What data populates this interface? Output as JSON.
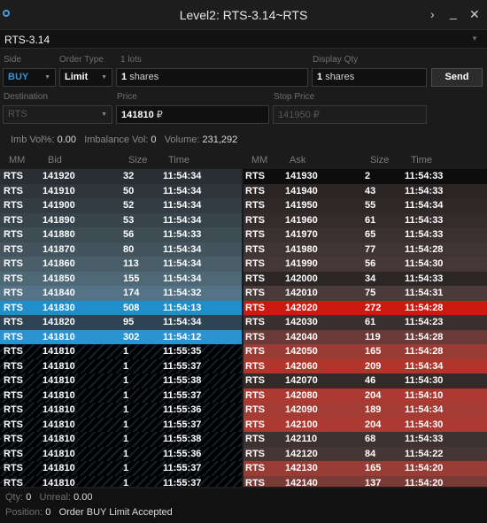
{
  "window": {
    "title": "Level2: RTS-3.14~RTS",
    "controls": {
      "expand": "›",
      "minimize": "_",
      "close": "✕"
    }
  },
  "symbol": "RTS-3.14",
  "order": {
    "side_label": "Side",
    "side_value": "BUY",
    "type_label": "Order Type",
    "type_value": "Limit",
    "lots_label": "1 lots",
    "qty_value": "1",
    "qty_unit": "shares",
    "display_qty_label": "Display Qty",
    "display_qty_value": "1",
    "display_qty_unit": "shares",
    "send_label": "Send",
    "destination_label": "Destination",
    "destination_value": "RTS",
    "price_label": "Price",
    "price_value": "141810",
    "price_unit": "₽",
    "stop_price_label": "Stop Price",
    "stop_price_value": "141950",
    "stop_price_unit": "₽"
  },
  "stats": {
    "imb_vol_label": "Imb Vol%:",
    "imb_vol_value": "0.00",
    "imbalance_label": "Imbalance Vol:",
    "imbalance_value": "0",
    "volume_label": "Volume:",
    "volume_value": "231,292"
  },
  "bid_book": {
    "columns": [
      "MM",
      "Bid",
      "Size",
      "Time"
    ],
    "rows": [
      {
        "mm": "RTS",
        "price": "141920",
        "size": "32",
        "time": "11:54:34",
        "bg": "#282e32",
        "hatch": false
      },
      {
        "mm": "RTS",
        "price": "141910",
        "size": "50",
        "time": "11:54:34",
        "bg": "#2e363b",
        "hatch": false
      },
      {
        "mm": "RTS",
        "price": "141900",
        "size": "52",
        "time": "11:54:34",
        "bg": "#323c42",
        "hatch": false
      },
      {
        "mm": "RTS",
        "price": "141890",
        "size": "53",
        "time": "11:54:34",
        "bg": "#38444b",
        "hatch": false
      },
      {
        "mm": "RTS",
        "price": "141880",
        "size": "56",
        "time": "11:54:33",
        "bg": "#3e4c54",
        "hatch": false
      },
      {
        "mm": "RTS",
        "price": "141870",
        "size": "80",
        "time": "11:54:34",
        "bg": "#44545e",
        "hatch": false
      },
      {
        "mm": "RTS",
        "price": "141860",
        "size": "113",
        "time": "11:54:34",
        "bg": "#4a5e69",
        "hatch": false
      },
      {
        "mm": "RTS",
        "price": "141850",
        "size": "155",
        "time": "11:54:34",
        "bg": "#4f6876",
        "hatch": false
      },
      {
        "mm": "RTS",
        "price": "141840",
        "size": "174",
        "time": "11:54:32",
        "bg": "#557386",
        "hatch": false
      },
      {
        "mm": "RTS",
        "price": "141830",
        "size": "508",
        "time": "11:54:13",
        "bg": "#1f8fcc",
        "hatch": false
      },
      {
        "mm": "RTS",
        "price": "141820",
        "size": "95",
        "time": "11:54:34",
        "bg": "#2c4454",
        "hatch": false
      },
      {
        "mm": "RTS",
        "price": "141810",
        "size": "302",
        "time": "11:54:12",
        "bg": "#2a93d0",
        "hatch": false
      },
      {
        "mm": "RTS",
        "price": "141810",
        "size": "1",
        "time": "11:55:35",
        "bg": "",
        "hatch": true
      },
      {
        "mm": "RTS",
        "price": "141810",
        "size": "1",
        "time": "11:55:37",
        "bg": "",
        "hatch": true
      },
      {
        "mm": "RTS",
        "price": "141810",
        "size": "1",
        "time": "11:55:38",
        "bg": "",
        "hatch": true
      },
      {
        "mm": "RTS",
        "price": "141810",
        "size": "1",
        "time": "11:55:37",
        "bg": "",
        "hatch": true
      },
      {
        "mm": "RTS",
        "price": "141810",
        "size": "1",
        "time": "11:55:36",
        "bg": "",
        "hatch": true
      },
      {
        "mm": "RTS",
        "price": "141810",
        "size": "1",
        "time": "11:55:37",
        "bg": "",
        "hatch": true
      },
      {
        "mm": "RTS",
        "price": "141810",
        "size": "1",
        "time": "11:55:38",
        "bg": "",
        "hatch": true
      },
      {
        "mm": "RTS",
        "price": "141810",
        "size": "1",
        "time": "11:55:36",
        "bg": "",
        "hatch": true
      },
      {
        "mm": "RTS",
        "price": "141810",
        "size": "1",
        "time": "11:55:37",
        "bg": "",
        "hatch": true
      },
      {
        "mm": "RTS",
        "price": "141810",
        "size": "1",
        "time": "11:55:37",
        "bg": "",
        "hatch": true
      }
    ]
  },
  "ask_book": {
    "columns": [
      "MM",
      "Ask",
      "Size",
      "Time"
    ],
    "rows": [
      {
        "mm": "RTS",
        "price": "141930",
        "size": "2",
        "time": "11:54:33",
        "bg": "#0c0c0c"
      },
      {
        "mm": "RTS",
        "price": "141940",
        "size": "43",
        "time": "11:54:33",
        "bg": "#2a2424"
      },
      {
        "mm": "RTS",
        "price": "141950",
        "size": "55",
        "time": "11:54:34",
        "bg": "#2f2828"
      },
      {
        "mm": "RTS",
        "price": "141960",
        "size": "61",
        "time": "11:54:33",
        "bg": "#342c2c"
      },
      {
        "mm": "RTS",
        "price": "141970",
        "size": "65",
        "time": "11:54:33",
        "bg": "#3a3030"
      },
      {
        "mm": "RTS",
        "price": "141980",
        "size": "77",
        "time": "11:54:28",
        "bg": "#403434"
      },
      {
        "mm": "RTS",
        "price": "141990",
        "size": "56",
        "time": "11:54:30",
        "bg": "#453737"
      },
      {
        "mm": "RTS",
        "price": "142000",
        "size": "34",
        "time": "11:54:33",
        "bg": "#2c2626"
      },
      {
        "mm": "RTS",
        "price": "142010",
        "size": "75",
        "time": "11:54:31",
        "bg": "#4a3a3a"
      },
      {
        "mm": "RTS",
        "price": "142020",
        "size": "272",
        "time": "11:54:28",
        "bg": "#cc1a10"
      },
      {
        "mm": "RTS",
        "price": "142030",
        "size": "61",
        "time": "11:54:23",
        "bg": "#3a2f2f"
      },
      {
        "mm": "RTS",
        "price": "142040",
        "size": "119",
        "time": "11:54:28",
        "bg": "#6a3a38"
      },
      {
        "mm": "RTS",
        "price": "142050",
        "size": "165",
        "time": "11:54:28",
        "bg": "#9a3c36"
      },
      {
        "mm": "RTS",
        "price": "142060",
        "size": "209",
        "time": "11:54:34",
        "bg": "#b2352c"
      },
      {
        "mm": "RTS",
        "price": "142070",
        "size": "46",
        "time": "11:54:30",
        "bg": "#342a2a"
      },
      {
        "mm": "RTS",
        "price": "142080",
        "size": "204",
        "time": "11:54:10",
        "bg": "#ac3a32"
      },
      {
        "mm": "RTS",
        "price": "142090",
        "size": "189",
        "time": "11:54:34",
        "bg": "#a23c34"
      },
      {
        "mm": "RTS",
        "price": "142100",
        "size": "204",
        "time": "11:54:30",
        "bg": "#ac3a32"
      },
      {
        "mm": "RTS",
        "price": "142110",
        "size": "68",
        "time": "11:54:33",
        "bg": "#3d3131"
      },
      {
        "mm": "RTS",
        "price": "142120",
        "size": "84",
        "time": "11:54:22",
        "bg": "#453535"
      },
      {
        "mm": "RTS",
        "price": "142130",
        "size": "165",
        "time": "11:54:20",
        "bg": "#9a3c36"
      },
      {
        "mm": "RTS",
        "price": "142140",
        "size": "137",
        "time": "11:54:20",
        "bg": "#7a3a36"
      }
    ]
  },
  "footer": {
    "qty_label": "Qty:",
    "qty_value": "0",
    "unreal_label": "Unreal:",
    "unreal_value": "0.00",
    "position_label": "Position:",
    "position_value": "0",
    "status_text": "Order BUY Limit Accepted"
  },
  "colors": {
    "side_buy": "#3d8fd6",
    "bid_highlight": "#1f8fcc",
    "ask_highlight": "#cc1a10"
  }
}
